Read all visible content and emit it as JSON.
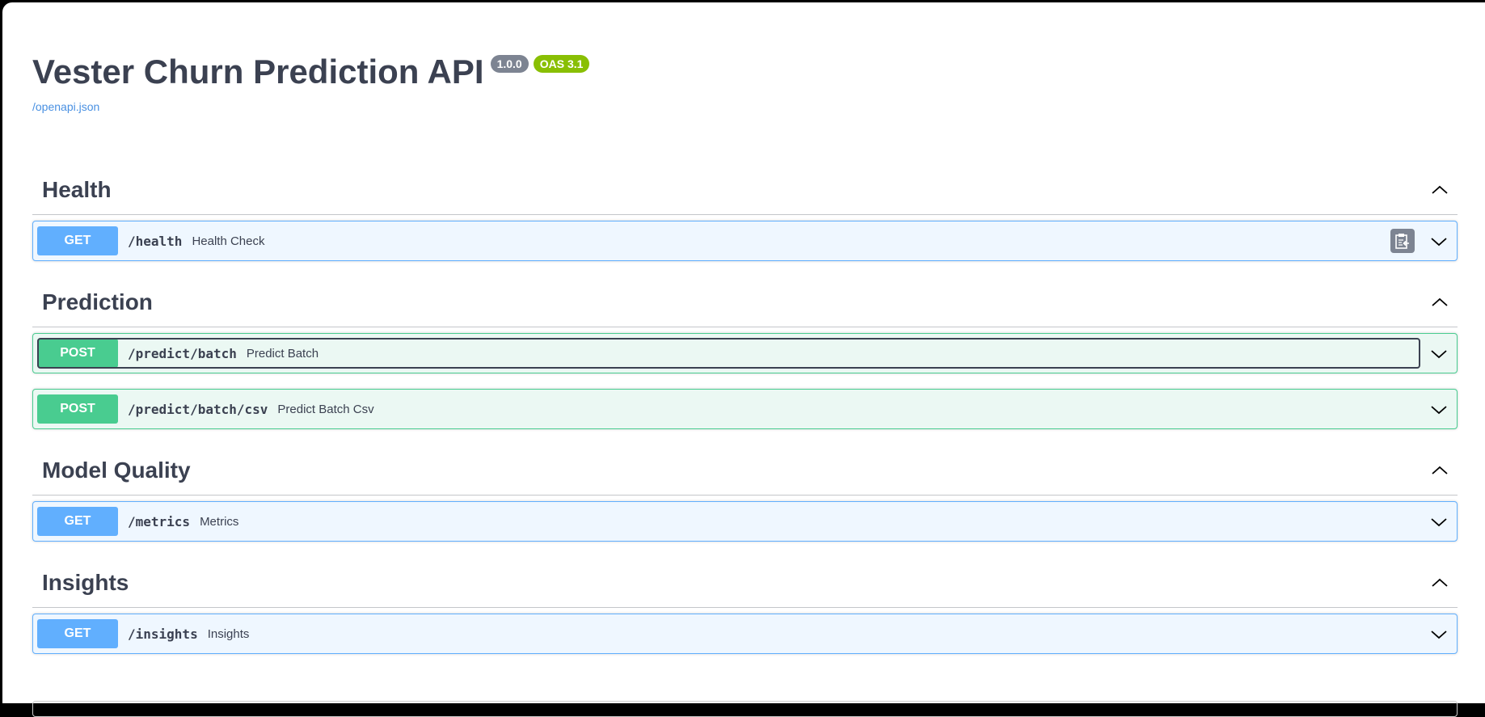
{
  "header": {
    "title": "Vester Churn Prediction API",
    "version": "1.0.0",
    "oas": "OAS 3.1",
    "spec_link": "/openapi.json"
  },
  "sections": [
    {
      "name": "Health",
      "ops": [
        {
          "method": "GET",
          "path": "/health",
          "summary": "Health Check"
        }
      ]
    },
    {
      "name": "Prediction",
      "ops": [
        {
          "method": "POST",
          "path": "/predict/batch",
          "summary": "Predict Batch"
        },
        {
          "method": "POST",
          "path": "/predict/batch/csv",
          "summary": "Predict Batch Csv"
        }
      ]
    },
    {
      "name": "Model Quality",
      "ops": [
        {
          "method": "GET",
          "path": "/metrics",
          "summary": "Metrics"
        }
      ]
    },
    {
      "name": "Insights",
      "ops": [
        {
          "method": "GET",
          "path": "/insights",
          "summary": "Insights"
        }
      ]
    }
  ],
  "colors": {
    "get": "#61affe",
    "post": "#49cc90",
    "version_badge": "#7d8492",
    "oas_badge": "#89bf04",
    "text": "#3b4151",
    "link": "#4990e2"
  }
}
